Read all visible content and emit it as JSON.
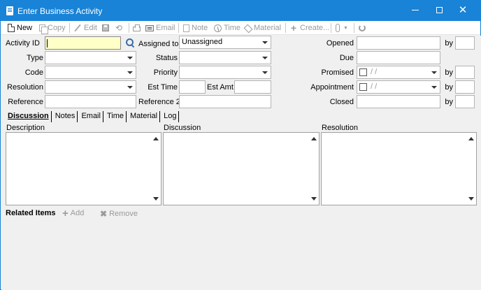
{
  "window": {
    "title": "Enter Business Activity",
    "controls": {
      "minimize": "",
      "maximize": "",
      "close": "✕"
    }
  },
  "toolbar": {
    "new": "New",
    "copy": "Copy",
    "edit": "Edit",
    "email": "Email",
    "note": "Note",
    "time": "Time",
    "material": "Material",
    "create": "Create..."
  },
  "form": {
    "activity_id": {
      "label": "Activity ID",
      "value": ""
    },
    "assigned_to": {
      "label": "Assigned to",
      "value": "Unassigned"
    },
    "opened": {
      "label": "Opened",
      "value": ""
    },
    "type": {
      "label": "Type",
      "value": ""
    },
    "status": {
      "label": "Status",
      "value": ""
    },
    "due": {
      "label": "Due",
      "value": ""
    },
    "code": {
      "label": "Code",
      "value": ""
    },
    "priority": {
      "label": "Priority",
      "value": ""
    },
    "promised": {
      "label": "Promised",
      "value": "/ /"
    },
    "resolution": {
      "label": "Resolution",
      "value": ""
    },
    "est_time": {
      "label": "Est Time",
      "value": ""
    },
    "est_amt": {
      "label": "Est Amt",
      "value": ""
    },
    "appointment": {
      "label": "Appointment",
      "value": "/ /"
    },
    "reference": {
      "label": "Reference",
      "value": ""
    },
    "reference2": {
      "label": "Reference 2",
      "value": ""
    },
    "closed": {
      "label": "Closed",
      "value": ""
    },
    "by_label": "by"
  },
  "tabs": [
    "Discussion",
    "Notes",
    "Email",
    "Time",
    "Material",
    "Log"
  ],
  "panes": {
    "description": "Description",
    "discussion": "Discussion",
    "resolution": "Resolution"
  },
  "related": {
    "title": "Related Items",
    "add": "Add",
    "remove": "Remove"
  },
  "colors": {
    "titlebar": "#1883d7",
    "focus_field": "#ffffc8"
  }
}
